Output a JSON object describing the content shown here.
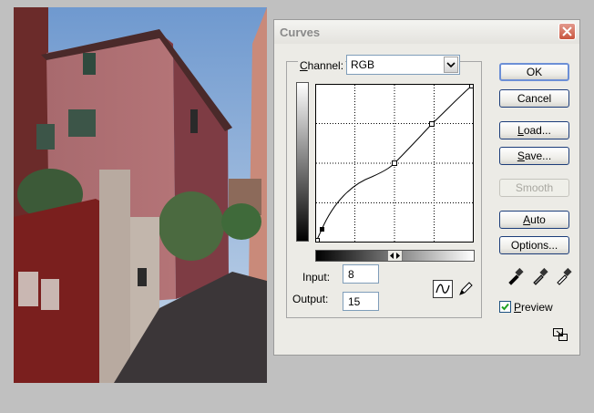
{
  "dialog": {
    "title": "Curves",
    "channel_label_underlined": "C",
    "channel_label_rest": "hannel:",
    "channel_value": "RGB",
    "input_label": "Input:",
    "input_value": "8",
    "output_label": "Output:",
    "output_value": "15",
    "preview_label_underlined": "P",
    "preview_label_rest": "review",
    "preview_checked": true
  },
  "buttons": [
    {
      "label": "OK",
      "underline": "",
      "rest": "OK",
      "state": "default"
    },
    {
      "label": "Cancel",
      "underline": "",
      "rest": "Cancel",
      "state": "normal"
    },
    {
      "label": "Load...",
      "underline": "L",
      "rest": "oad...",
      "state": "normal"
    },
    {
      "label": "Save...",
      "underline": "S",
      "rest": "ave...",
      "state": "normal"
    },
    {
      "label": "Smooth",
      "underline": "",
      "rest": "Smooth",
      "state": "disabled"
    },
    {
      "label": "Auto",
      "underline": "A",
      "rest": "uto",
      "state": "normal"
    },
    {
      "label": "Options...",
      "underline": "T",
      "rest": "Op|tions...",
      "state": "normal"
    }
  ],
  "curve_points": [
    {
      "input": 8,
      "output": 15
    },
    {
      "input": 128,
      "output": 128
    },
    {
      "input": 190,
      "output": 190
    },
    {
      "input": 255,
      "output": 255
    }
  ],
  "icons": {
    "close": "close-icon",
    "dropdown": "chevron-down-icon",
    "curve_tool": "curve-tool-icon",
    "pencil_tool": "pencil-icon",
    "black_eyedropper": "eyedropper-black-icon",
    "gray_eyedropper": "eyedropper-gray-icon",
    "white_eyedropper": "eyedropper-white-icon",
    "expand": "expand-icon"
  },
  "colors": {
    "focus": "#6c8fd6",
    "close_button": "#c9553e"
  }
}
